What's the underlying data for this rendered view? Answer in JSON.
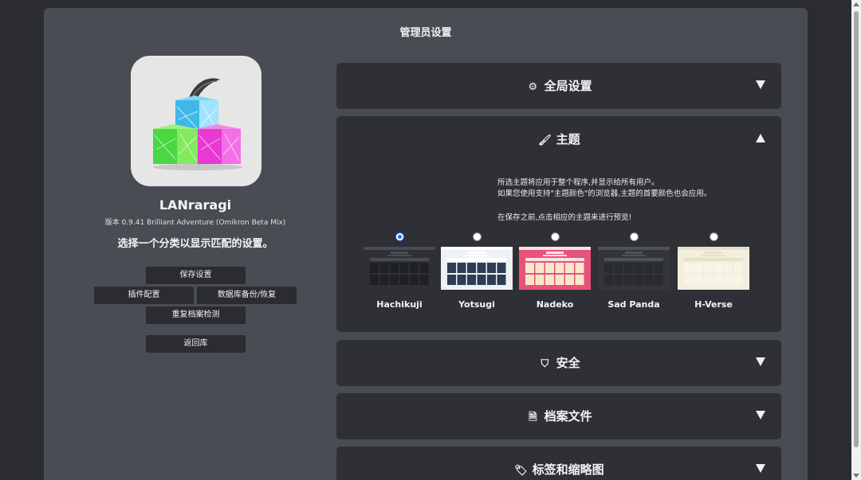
{
  "page_title": "管理员设置",
  "app": {
    "name": "LANraragi",
    "version": "版本 0.9.41 Brilliant Adventure (Omikron Beta Mix)",
    "subtitle": "选择一个分类以显示匹配的设置。"
  },
  "buttons": {
    "save": "保存设置",
    "plugins": "插件配置",
    "backup": "数据库备份/恢复",
    "duplicates": "重复档案检测",
    "return": "返回库"
  },
  "sections": {
    "global": {
      "title": "全局设置",
      "icon": "users-cog-icon"
    },
    "theme": {
      "title": "主题",
      "icon": "paint-brush-icon",
      "desc_line1": "所选主题将应用于整个程序,并显示给所有用户。",
      "desc_line2": "如果您使用支持\"主题颜色\"的浏览器,主题的首要颜色也会应用。",
      "preview_note": "在保存之前,点击相应的主题来进行预览!",
      "options": [
        {
          "name": "Hachikuji",
          "selected": true,
          "bg": "#2f3035",
          "bar": "#4a4c53",
          "grid": "#1f2024"
        },
        {
          "name": "Yotsugi",
          "selected": false,
          "bg": "#eef2f5",
          "bar": "#ffffff",
          "grid": "#2e3d55"
        },
        {
          "name": "Nadeko",
          "selected": false,
          "bg": "#e8527a",
          "bar": "#fbe0e7",
          "grid": "#f6e8c9"
        },
        {
          "name": "Sad Panda",
          "selected": false,
          "bg": "#34353b",
          "bar": "#4f535b",
          "grid": "#2a2b30"
        },
        {
          "name": "H-Verse",
          "selected": false,
          "bg": "#f2efe0",
          "bar": "#e7e1c8",
          "grid": "#f7f4e8"
        }
      ]
    },
    "security": {
      "title": "安全",
      "icon": "shield-icon"
    },
    "archives": {
      "title": "档案文件",
      "icon": "file-archive-icon"
    },
    "tags": {
      "title": "标签和缩略图",
      "icon": "tags-icon"
    }
  }
}
